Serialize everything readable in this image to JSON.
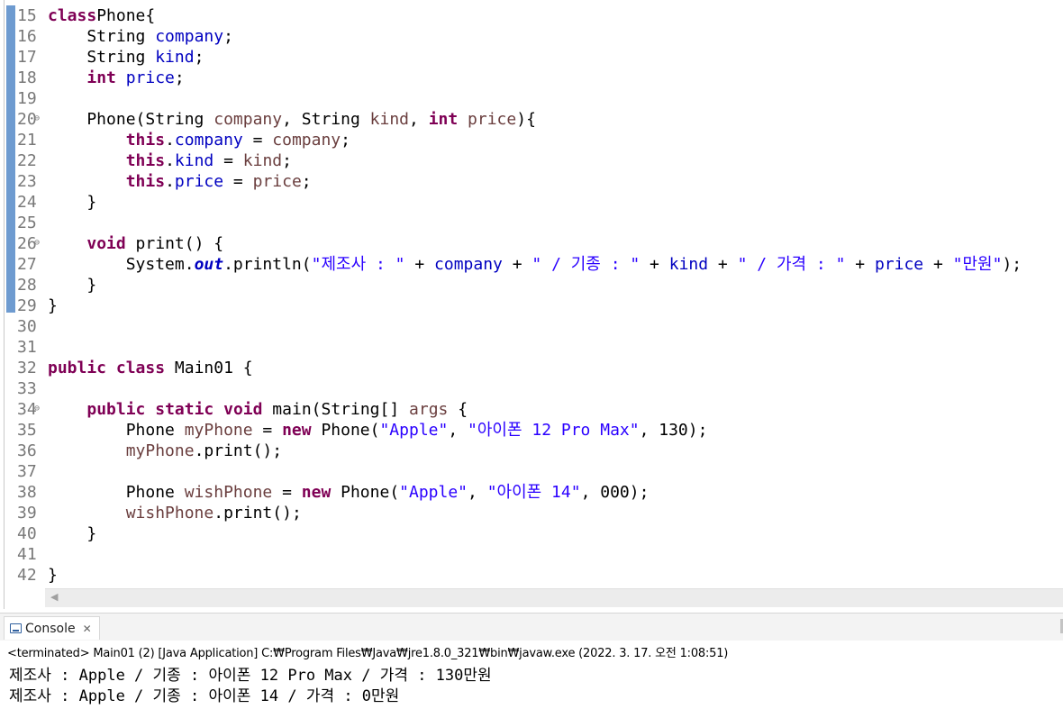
{
  "editor": {
    "lines": [
      {
        "no": "15",
        "fold": false,
        "tokens": [
          [
            "kw",
            "class"
          ],
          [
            "",
            "Phone{"
          ]
        ]
      },
      {
        "no": "16",
        "fold": false,
        "tokens": [
          [
            "",
            "    String "
          ],
          [
            "fld",
            "company"
          ],
          [
            "",
            ";"
          ]
        ]
      },
      {
        "no": "17",
        "fold": false,
        "tokens": [
          [
            "",
            "    String "
          ],
          [
            "fld",
            "kind"
          ],
          [
            "",
            ";"
          ]
        ]
      },
      {
        "no": "18",
        "fold": false,
        "tokens": [
          [
            "",
            "    "
          ],
          [
            "kw",
            "int"
          ],
          [
            "fld",
            " price"
          ],
          [
            "",
            ";"
          ]
        ]
      },
      {
        "no": "19",
        "fold": false,
        "tokens": []
      },
      {
        "no": "20",
        "fold": true,
        "tokens": [
          [
            "",
            "    Phone(String "
          ],
          [
            "prm",
            "company"
          ],
          [
            "",
            ", String "
          ],
          [
            "prm",
            "kind"
          ],
          [
            "",
            ", "
          ],
          [
            "kw",
            "int"
          ],
          [
            "prm",
            " price"
          ],
          [
            "",
            "){"
          ]
        ]
      },
      {
        "no": "21",
        "fold": false,
        "tokens": [
          [
            "",
            "        "
          ],
          [
            "kw",
            "this"
          ],
          [
            "",
            "."
          ],
          [
            "fld",
            "company"
          ],
          [
            "",
            " = "
          ],
          [
            "prm",
            "company"
          ],
          [
            "",
            ";"
          ]
        ]
      },
      {
        "no": "22",
        "fold": false,
        "tokens": [
          [
            "",
            "        "
          ],
          [
            "kw",
            "this"
          ],
          [
            "",
            "."
          ],
          [
            "fld",
            "kind"
          ],
          [
            "",
            " = "
          ],
          [
            "prm",
            "kind"
          ],
          [
            "",
            ";"
          ]
        ]
      },
      {
        "no": "23",
        "fold": false,
        "tokens": [
          [
            "",
            "        "
          ],
          [
            "kw",
            "this"
          ],
          [
            "",
            "."
          ],
          [
            "fld",
            "price"
          ],
          [
            "",
            " = "
          ],
          [
            "prm",
            "price"
          ],
          [
            "",
            ";"
          ]
        ]
      },
      {
        "no": "24",
        "fold": false,
        "tokens": [
          [
            "",
            "    }"
          ]
        ]
      },
      {
        "no": "25",
        "fold": false,
        "tokens": []
      },
      {
        "no": "26",
        "fold": true,
        "tokens": [
          [
            "",
            "    "
          ],
          [
            "kw",
            "void"
          ],
          [
            "",
            " print() {"
          ]
        ]
      },
      {
        "no": "27",
        "fold": false,
        "tokens": [
          [
            "",
            "        System."
          ],
          [
            "sfld",
            "out"
          ],
          [
            "",
            ".println("
          ],
          [
            "str",
            "\"제조사 : \""
          ],
          [
            "",
            " + "
          ],
          [
            "fld",
            "company"
          ],
          [
            "",
            " + "
          ],
          [
            "str",
            "\" / 기종 : \""
          ],
          [
            "",
            " + "
          ],
          [
            "fld",
            "kind"
          ],
          [
            "",
            " + "
          ],
          [
            "str",
            "\" / 가격 : \""
          ],
          [
            "",
            " + "
          ],
          [
            "fld",
            "price"
          ],
          [
            "",
            " + "
          ],
          [
            "str",
            "\"만원\""
          ],
          [
            "",
            ");"
          ]
        ]
      },
      {
        "no": "28",
        "fold": false,
        "tokens": [
          [
            "",
            "    }"
          ]
        ]
      },
      {
        "no": "29",
        "fold": false,
        "tokens": [
          [
            "",
            "}"
          ]
        ]
      },
      {
        "no": "30",
        "fold": false,
        "tokens": []
      },
      {
        "no": "31",
        "fold": false,
        "tokens": []
      },
      {
        "no": "32",
        "fold": false,
        "tokens": [
          [
            "kw",
            "public"
          ],
          [
            "",
            " "
          ],
          [
            "kw",
            "class"
          ],
          [
            "",
            " Main01 {"
          ]
        ]
      },
      {
        "no": "33",
        "fold": false,
        "tokens": []
      },
      {
        "no": "34",
        "fold": true,
        "tokens": [
          [
            "",
            "    "
          ],
          [
            "kw",
            "public"
          ],
          [
            "",
            " "
          ],
          [
            "kw",
            "static"
          ],
          [
            "",
            " "
          ],
          [
            "kw",
            "void"
          ],
          [
            "",
            " main(String[] "
          ],
          [
            "prm",
            "args"
          ],
          [
            "",
            " {"
          ]
        ]
      },
      {
        "no": "35",
        "fold": false,
        "tokens": [
          [
            "",
            "        Phone "
          ],
          [
            "prm",
            "myPhone"
          ],
          [
            "",
            " = "
          ],
          [
            "kw",
            "new"
          ],
          [
            "",
            " Phone("
          ],
          [
            "str",
            "\"Apple\""
          ],
          [
            "",
            ", "
          ],
          [
            "str",
            "\"아이폰 12 Pro Max\""
          ],
          [
            "",
            ", 130);"
          ]
        ]
      },
      {
        "no": "36",
        "fold": false,
        "tokens": [
          [
            "",
            "        "
          ],
          [
            "prm",
            "myPhone"
          ],
          [
            "",
            ".print();"
          ]
        ]
      },
      {
        "no": "37",
        "fold": false,
        "tokens": []
      },
      {
        "no": "38",
        "fold": false,
        "tokens": [
          [
            "",
            "        Phone "
          ],
          [
            "prm",
            "wishPhone"
          ],
          [
            "",
            " = "
          ],
          [
            "kw",
            "new"
          ],
          [
            "",
            " Phone("
          ],
          [
            "str",
            "\"Apple\""
          ],
          [
            "",
            ", "
          ],
          [
            "str",
            "\"아이폰 14\""
          ],
          [
            "",
            ", 000);"
          ]
        ]
      },
      {
        "no": "39",
        "fold": false,
        "tokens": [
          [
            "",
            "        "
          ],
          [
            "prm",
            "wishPhone"
          ],
          [
            "",
            ".print();"
          ]
        ]
      },
      {
        "no": "40",
        "fold": false,
        "tokens": [
          [
            "",
            "    }"
          ]
        ]
      },
      {
        "no": "41",
        "fold": false,
        "tokens": []
      },
      {
        "no": "42",
        "fold": false,
        "tokens": [
          [
            "",
            "}"
          ]
        ]
      }
    ],
    "fold_glyph": "⊖",
    "scroll_left_glyph": "◀"
  },
  "console": {
    "tab_label": "Console",
    "close_glyph": "✕",
    "status": "<terminated> Main01 (2) [Java Application] C:₩Program Files₩Java₩jre1.8.0_321₩bin₩javaw.exe (2022. 3. 17. 오전 1:08:51)",
    "output": [
      "제조사 : Apple / 기종 : 아이폰 12 Pro Max / 가격 : 130만원",
      "제조사 : Apple / 기종 : 아이폰 14 / 가격 : 0만원"
    ]
  },
  "colors": {
    "keyword": "#7f0055",
    "field": "#0000c0",
    "parameter": "#6a3e3e",
    "string": "#2a00ff",
    "line_number": "#787878",
    "change_bar": "#6e9bd0"
  }
}
